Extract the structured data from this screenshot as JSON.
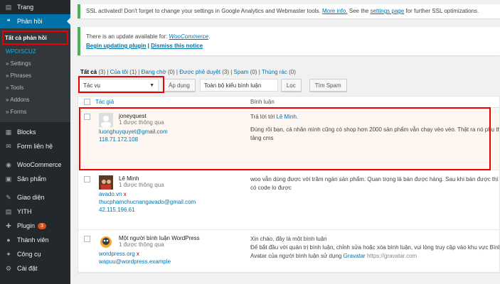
{
  "sidebar": {
    "top_item": "Trang",
    "active_item": "Phản hồi",
    "sub_items": {
      "all_comments": "Tất cả phản hồi",
      "plugin": "WPDISCUZ",
      "settings": "» Settings",
      "phrases": "» Phrases",
      "tools": "» Tools",
      "addons": "» Addons",
      "forms": "» Forms"
    },
    "items_after": [
      {
        "label": "Blocks",
        "icon": "blocks-icon",
        "glyph": "▦"
      },
      {
        "label": "Form liên hệ",
        "icon": "mail-icon",
        "glyph": "✉"
      },
      {
        "label": "WooCommerce",
        "icon": "woocommerce-icon",
        "glyph": "◉"
      },
      {
        "label": "Sản phẩm",
        "icon": "products-icon",
        "glyph": "▣"
      },
      {
        "label": "Giao diện",
        "icon": "appearance-icon",
        "glyph": "✎"
      },
      {
        "label": "YITH",
        "icon": "yith-icon",
        "glyph": "▤"
      },
      {
        "label": "Plugin",
        "icon": "plugin-icon",
        "glyph": "✚",
        "badge": "3"
      },
      {
        "label": "Thành viên",
        "icon": "users-icon",
        "glyph": "●"
      },
      {
        "label": "Công cụ",
        "icon": "tools-icon",
        "glyph": "✦"
      },
      {
        "label": "Cài đặt",
        "icon": "settings-icon",
        "glyph": "⚙"
      }
    ]
  },
  "notices": {
    "ssl": {
      "text": "SSL activated!  Don't forget to change your settings in Google Analytics and Webmaster tools.",
      "more_info": "More info.",
      "see_the": "See the",
      "settings_page": "settings page",
      "tail": "for further SSL optimizations."
    },
    "update": {
      "text": "There is an update available for:",
      "plugin": "WooCommerce",
      "begin": "Begin updating plugin",
      "sep": "|",
      "dismiss": "Dismiss this notice"
    }
  },
  "filters": {
    "all": "Tất cả",
    "all_count": "(3)",
    "mine": "Của tôi",
    "mine_count": "(1)",
    "pending": "Đang chờ",
    "pending_count": "(0)",
    "approved": "Được phê duyệt",
    "approved_count": "(3)",
    "spam": "Spam",
    "spam_count": "(0)",
    "trash": "Thùng rác",
    "trash_count": "(0)",
    "sep": "|"
  },
  "tablenav": {
    "bulk_action": "Tác vụ",
    "apply": "Áp dụng",
    "type_filter": "Toàn bộ kiểu bình luận",
    "filter": "Lọc",
    "search_spam": "Tìm Spam"
  },
  "table": {
    "col_author": "Tác giả",
    "col_comment": "Bình luận",
    "rows": [
      {
        "name": "joneyquest",
        "approved": "1 được thông qua",
        "links": [
          "luonghuyquyet@gmail.com",
          "118.71.172.108"
        ],
        "reply_to": "Trả lời tới",
        "reply_name": "Lê Minh.",
        "text1": "Đúng rồi bạn, cá nhân mình cũng có shop hơn 2000 sản phẩm vẫn chạy vèo vèo. Thật ra nó phụ thuộc",
        "text2": "tảng cms"
      },
      {
        "name": "Lê Minh",
        "approved": "1 được thông qua",
        "links": [
          "avado.vn",
          "thucphamchucnangavado@gmail.com",
          "42.115.196.61"
        ],
        "text1": "woo vẫn dùng được với trăm ngàn sản phẩm. Quan trọng là bán được hàng. Sau khi bán được thì phải",
        "text2": "có code lo được"
      },
      {
        "name": "Một người bình luận WordPress",
        "approved": "1 được thông qua",
        "links": [
          "wordpress.org",
          "wapuu@wordpress.example"
        ],
        "text1": "Xin chào, đây là một bình luận",
        "text2": "Để bắt đầu với quản trị bình luận, chỉnh sửa hoặc xóa bình luận, vui lòng truy cập vào khu vực Bình",
        "text3_pre": "Avatar của người bình luận sử dụng",
        "gravatar": "Gravatar",
        "gravatar_url": "https://gravatar.com"
      }
    ]
  },
  "colors": {
    "sidebar_bg": "#23282d",
    "active_bg": "#0073aa",
    "link": "#0073aa",
    "highlight": "#e00000"
  }
}
